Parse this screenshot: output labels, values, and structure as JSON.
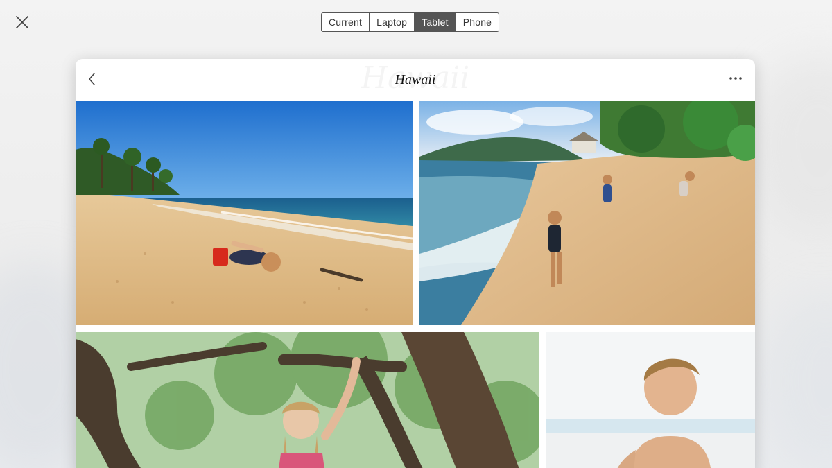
{
  "toolbar": {
    "close_icon": "close-icon",
    "device_options": [
      {
        "label": "Current",
        "active": false
      },
      {
        "label": "Laptop",
        "active": false
      },
      {
        "label": "Tablet",
        "active": true
      },
      {
        "label": "Phone",
        "active": false
      }
    ]
  },
  "preview": {
    "title": "Hawaii",
    "back_icon": "chevron-left-icon",
    "menu_icon": "more-horizontal-icon",
    "photos": [
      {
        "name": "beach-child-digging-photo"
      },
      {
        "name": "beach-boys-sand-slope-photo"
      },
      {
        "name": "girl-in-tree-photo"
      },
      {
        "name": "toddler-beach-photo"
      }
    ]
  },
  "colors": {
    "accent": "#555555",
    "active_text": "#ffffff"
  }
}
